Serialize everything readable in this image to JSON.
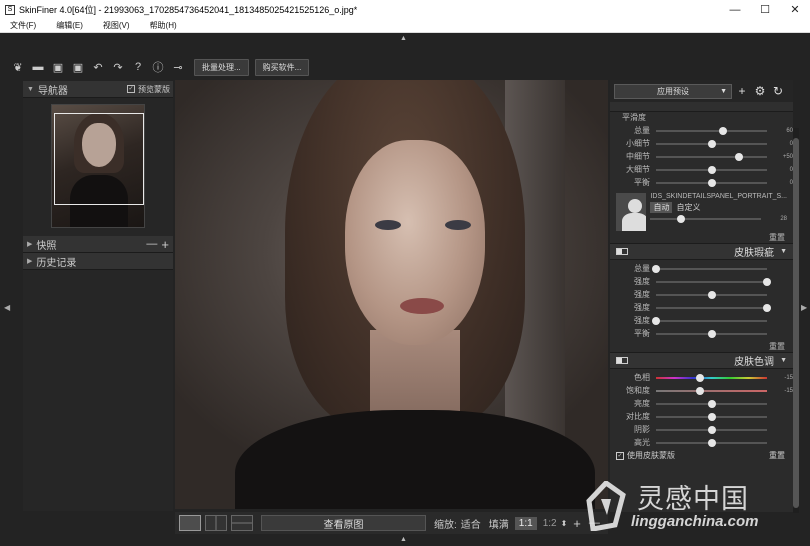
{
  "window": {
    "title": "SkinFiner 4.0[64位] - 21993063_1702854736452041_1813485025421525126_o.jpg*",
    "minimize_icon": "minimize-icon",
    "maximize_icon": "maximize-icon",
    "close_icon": "close-icon"
  },
  "menu": [
    "文件(F)",
    "编辑(E)",
    "视图(V)",
    "帮助(H)"
  ],
  "toolbar": {
    "batch_label": "批量处理...",
    "buy_label": "购买软件..."
  },
  "navigator": {
    "title": "导航器",
    "preview_mask_label": "预览蒙版",
    "preview_mask_checked": true
  },
  "snapshots": {
    "title": "快照",
    "minus": "—",
    "plus": "+"
  },
  "history": {
    "title": "历史记录"
  },
  "bottombar": {
    "compare_label": "查看原图",
    "zoom_label": "缩放:",
    "fit_label": "适合",
    "fill_label": "填满",
    "ratio_1": "1:1",
    "ratio_2": "1:2",
    "plus": "+",
    "minus": "—"
  },
  "right": {
    "preset_label": "应用预设",
    "smooth": {
      "header": "平滑度",
      "sliders": [
        {
          "label": "总量",
          "value": "60",
          "pos": 0.6
        },
        {
          "label": "小细节",
          "value": "0",
          "pos": 0.5
        },
        {
          "label": "中细节",
          "value": "+50",
          "pos": 0.75
        },
        {
          "label": "大细节",
          "value": "0",
          "pos": 0.5
        },
        {
          "label": "平衡",
          "value": "0",
          "pos": 0.5
        }
      ],
      "preset_name": "IDS_SKINDETAILSPANEL_PORTRAIT_S...",
      "auto_label": "自动",
      "custom_label": "自定义",
      "preset_value": "28",
      "preset_pos": 0.28,
      "reset_label": "重置"
    },
    "blemish": {
      "title": "皮肤瑕疵",
      "sliders": [
        {
          "label": "总量",
          "value": "",
          "pos": 0.0
        },
        {
          "label": "强度",
          "value": "",
          "pos": 1.0
        },
        {
          "label": "强度",
          "value": "",
          "pos": 0.5
        },
        {
          "label": "强度",
          "value": "",
          "pos": 1.0
        },
        {
          "label": "强度",
          "value": "",
          "pos": 0.0
        },
        {
          "label": "平衡",
          "value": "",
          "pos": 0.5
        }
      ],
      "reset_label": "重置"
    },
    "tone": {
      "title": "皮肤色调",
      "sliders": [
        {
          "label": "色相",
          "value": "-15",
          "pos": 0.4
        },
        {
          "label": "饱和度",
          "value": "-15",
          "pos": 0.4
        },
        {
          "label": "亮度",
          "value": "",
          "pos": 0.5
        },
        {
          "label": "对比度",
          "value": "",
          "pos": 0.5
        },
        {
          "label": "阴影",
          "value": "",
          "pos": 0.5
        },
        {
          "label": "高光",
          "value": "",
          "pos": 0.5
        }
      ],
      "use_mask_label": "使用皮肤蒙版",
      "use_mask_checked": true,
      "reset_label": "重置"
    }
  },
  "watermark": {
    "brand": "灵感中国",
    "url": "lingganchina.com"
  }
}
